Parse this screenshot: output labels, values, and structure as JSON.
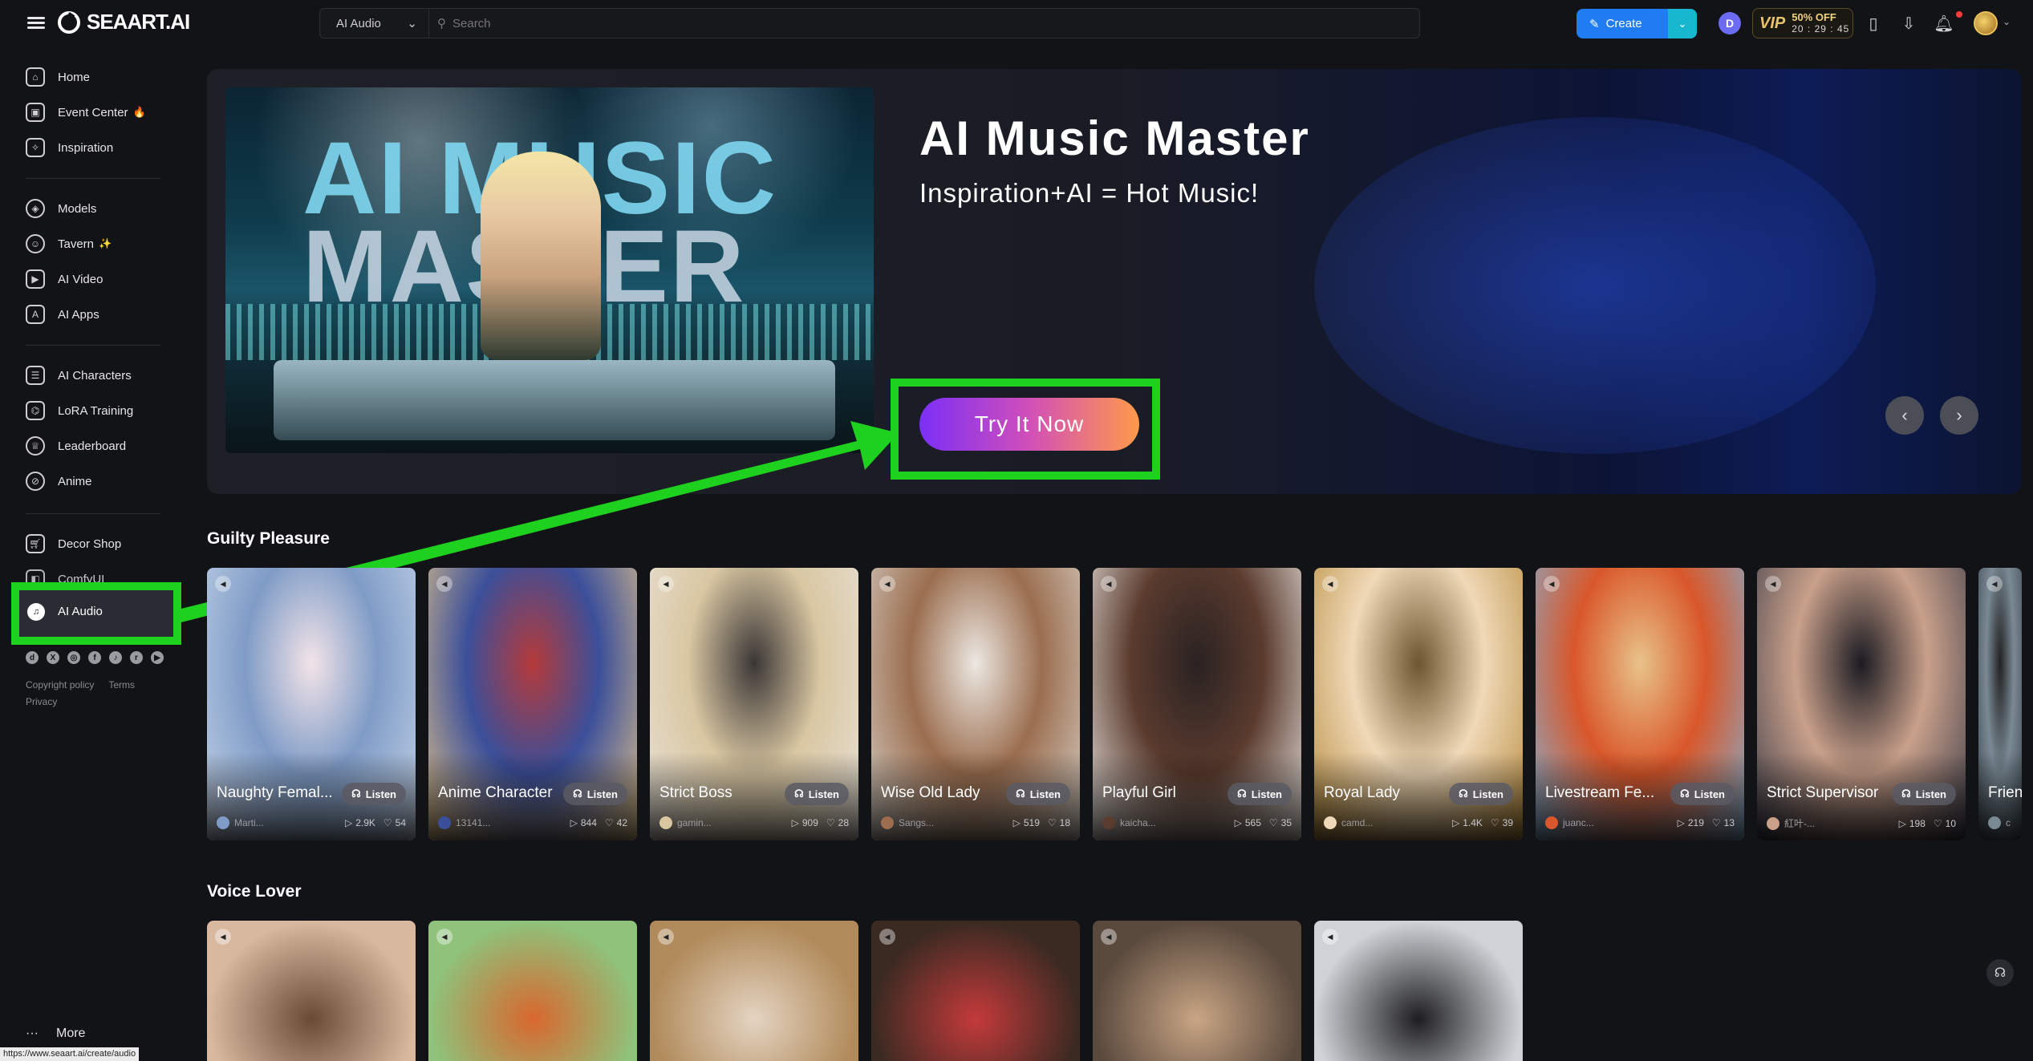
{
  "header": {
    "logo_text": "SEAART.AI",
    "search_category": "AI Audio",
    "search_placeholder": "Search",
    "create_label": "Create",
    "vip_badge": "VIP",
    "vip_discount": "50% OFF",
    "vip_timer": "20 : 29 : 45",
    "icons": [
      "menu-icon",
      "discord-icon",
      "phone-icon",
      "download-icon",
      "bell-icon",
      "avatar"
    ]
  },
  "sidebar": {
    "group1": [
      {
        "label": "Home",
        "icon": "home-icon"
      },
      {
        "label": "Event Center",
        "icon": "gift-icon",
        "badge": "🔥"
      },
      {
        "label": "Inspiration",
        "icon": "magic-icon"
      }
    ],
    "group2": [
      {
        "label": "Models",
        "icon": "cube-icon"
      },
      {
        "label": "Tavern",
        "icon": "chat-icon",
        "badge": "✨"
      },
      {
        "label": "AI Video",
        "icon": "video-icon"
      },
      {
        "label": "AI Apps",
        "icon": "apps-icon"
      }
    ],
    "group3": [
      {
        "label": "AI Characters",
        "icon": "character-icon"
      },
      {
        "label": "LoRA Training",
        "icon": "training-icon"
      },
      {
        "label": "Leaderboard",
        "icon": "trophy-icon"
      },
      {
        "label": "Anime",
        "icon": "anime-icon"
      }
    ],
    "group4": [
      {
        "label": "Decor Shop",
        "icon": "shop-icon"
      },
      {
        "label": "ComfyUI",
        "icon": "comfy-icon"
      },
      {
        "label": "AI Audio",
        "icon": "audio-icon"
      }
    ],
    "social_icons": [
      "discord-icon",
      "x-icon",
      "instagram-icon",
      "facebook-icon",
      "tiktok-icon",
      "reddit-icon",
      "youtube-icon"
    ],
    "footer_links": [
      "Copyright policy",
      "Terms",
      "Privacy"
    ],
    "more_label": "More",
    "status_url": "https://www.seaart.ai/create/audio"
  },
  "banner": {
    "image_text_line1": "AI MUSIC",
    "image_text_line2": "MASTER",
    "title": "AI Music Master",
    "subtitle": "Inspiration+AI = Hot Music!",
    "cta_label": "Try It Now",
    "prev": "‹",
    "next": "›"
  },
  "sections": {
    "guilty_title": "Guilty Pleasure",
    "voice_title": "Voice Lover"
  },
  "listen_label": "Listen",
  "cards": [
    {
      "name": "Naughty Femal...",
      "author": "Marti...",
      "plays": "2.9K",
      "likes": "54",
      "colors": [
        "#c7d6ea",
        "#7f9cc6",
        "#f3e4e8"
      ]
    },
    {
      "name": "Anime Character",
      "author": "13141...",
      "plays": "844",
      "likes": "42",
      "colors": [
        "#e9c98a",
        "#3b4f9a",
        "#b53a3a"
      ]
    },
    {
      "name": "Strict Boss",
      "author": "gamin...",
      "plays": "909",
      "likes": "28",
      "colors": [
        "#e9e3da",
        "#d9c7a2",
        "#3b3636"
      ]
    },
    {
      "name": "Wise Old Lady",
      "author": "Sangs...",
      "plays": "519",
      "likes": "18",
      "colors": [
        "#dad4cb",
        "#9b6e4f",
        "#ece8e2"
      ]
    },
    {
      "name": "Playful Girl",
      "author": "kaicha...",
      "plays": "565",
      "likes": "35",
      "colors": [
        "#f1ede8",
        "#5a3b2e",
        "#2a2222"
      ]
    },
    {
      "name": "Royal Lady",
      "author": "camd...",
      "plays": "1.4K",
      "likes": "39",
      "colors": [
        "#b58a3a",
        "#f0d9b8",
        "#6e5530"
      ]
    },
    {
      "name": "Livestream Fe...",
      "author": "juanc...",
      "plays": "219",
      "likes": "13",
      "colors": [
        "#7fb4d8",
        "#d9572a",
        "#e8c38a"
      ]
    },
    {
      "name": "Strict Supervisor",
      "author": "紅叶-...",
      "plays": "198",
      "likes": "10",
      "colors": [
        "#3a3b48",
        "#c9a08a",
        "#1b1b22"
      ]
    },
    {
      "name": "Frien",
      "author": "c",
      "plays": "",
      "likes": "",
      "colors": [
        "#3f4a52",
        "#7a8a95",
        "#222"
      ]
    }
  ],
  "voice_cards": [
    {
      "colors": [
        "#d9b8a0",
        "#6b4a34"
      ]
    },
    {
      "colors": [
        "#8fc27a",
        "#d9672e"
      ]
    },
    {
      "colors": [
        "#b08a5a",
        "#e4d4c2"
      ]
    },
    {
      "colors": [
        "#3b2a22",
        "#c43a3a"
      ]
    },
    {
      "colors": [
        "#5a4a3e",
        "#c9a584"
      ]
    },
    {
      "colors": [
        "#cfd2d6",
        "#1e1e22"
      ]
    }
  ]
}
